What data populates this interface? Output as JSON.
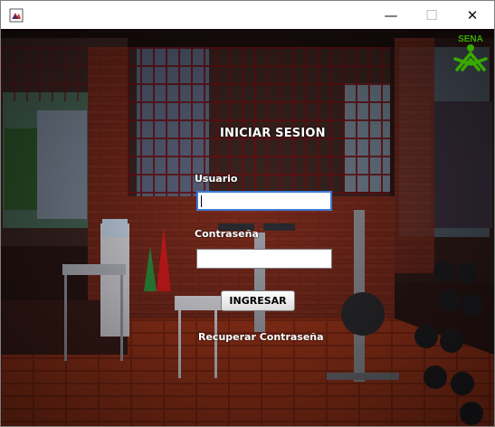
{
  "window": {
    "icon": "java-cup-icon",
    "controls": {
      "minimize": "—",
      "maximize": "☐",
      "close": "✕"
    }
  },
  "login": {
    "title": "INICIAR SESION",
    "user_label": "Usuario",
    "user_value": "",
    "password_label": "Contraseña",
    "password_value": "",
    "submit_label": "INGRESAR",
    "recover_link": "Recuperar Contraseña"
  },
  "brand": {
    "logo_text": "SENA",
    "logo_color": "#39a900"
  }
}
